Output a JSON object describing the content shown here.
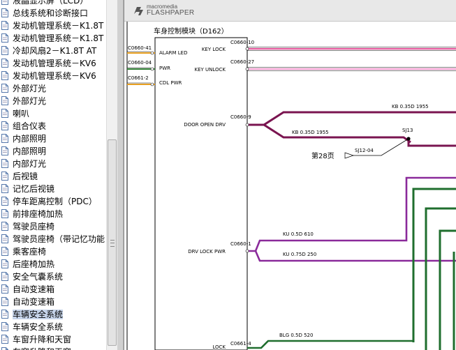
{
  "sidebar": {
    "items": [
      {
        "label": "液晶显示屏（LCD）"
      },
      {
        "label": "总线系统和诊断接口"
      },
      {
        "label": "发动机管理系统－K1.8T"
      },
      {
        "label": "发动机管理系统－K1.8T"
      },
      {
        "label": "冷却风扇2－K1.8T AT"
      },
      {
        "label": "发动机管理系统－KV6"
      },
      {
        "label": "发动机管理系统－KV6"
      },
      {
        "label": "外部灯光"
      },
      {
        "label": "外部灯光"
      },
      {
        "label": "喇叭"
      },
      {
        "label": "组合仪表"
      },
      {
        "label": "内部照明"
      },
      {
        "label": "内部照明"
      },
      {
        "label": "内部灯光"
      },
      {
        "label": "后视镜"
      },
      {
        "label": "记忆后视镜"
      },
      {
        "label": "停车距离控制（PDC）"
      },
      {
        "label": "前排座椅加热"
      },
      {
        "label": "驾驶员座椅"
      },
      {
        "label": "驾驶员座椅（带记忆功能"
      },
      {
        "label": "乘客座椅"
      },
      {
        "label": "后座椅加热"
      },
      {
        "label": "安全气囊系统"
      },
      {
        "label": "自动变速箱"
      },
      {
        "label": "自动变速箱"
      },
      {
        "label": "车辆安全系统",
        "selected": true
      },
      {
        "label": "车辆安全系统"
      },
      {
        "label": "车窗升降和天窗"
      },
      {
        "label": "车窗升降和天窗"
      }
    ]
  },
  "viewer": {
    "brand_small": "macromedia",
    "brand_big": "FLASHPAPER"
  },
  "diagram": {
    "module_title": "车身控制模块（D162）",
    "left_pins": [
      {
        "connector": "C0660-41",
        "signal": "ALARM LED",
        "wire_color": "#e8a020"
      },
      {
        "connector": "C0660-04",
        "signal": "PWR",
        "wire_color": "#2e7d32"
      },
      {
        "connector": "C0661-2",
        "signal": "CDL PWR",
        "wire_color": "#e8a020"
      }
    ],
    "right_pins": [
      {
        "signal": "KEY LOCK",
        "connector": "C0660-10",
        "wire_color": "#e0559a"
      },
      {
        "signal": "KEY UNLOCK",
        "connector": "C0660-27",
        "wire_color": "#f0a0d0"
      },
      {
        "signal": "DOOR OPEN DRV",
        "connector": "C0660-9",
        "wire_color": "#7a1450"
      },
      {
        "signal": "DRV LOCK PWR",
        "connector": "C0660-1",
        "wire_color": "#8a2a9a"
      },
      {
        "signal": "LOCK",
        "connector": "C0661-4",
        "wire_color": "#2e7d32"
      }
    ],
    "wire_labels": {
      "kb_upper": "KB 0.35D 1955",
      "kb_lower": "KB 0.35D 1955",
      "splice": "SJ13",
      "splice_ref": "SJ12-04",
      "page_ref": "第28页",
      "ku_upper": "KU 0.5D 610",
      "ku_lower": "KU 0.75D 250",
      "blg": "BLG 0.5D 520"
    },
    "colors": {
      "door_wire": "#7a1450",
      "lock_pwr_wire": "#8a2a9a",
      "green_wire": "#1f6e2e"
    }
  }
}
